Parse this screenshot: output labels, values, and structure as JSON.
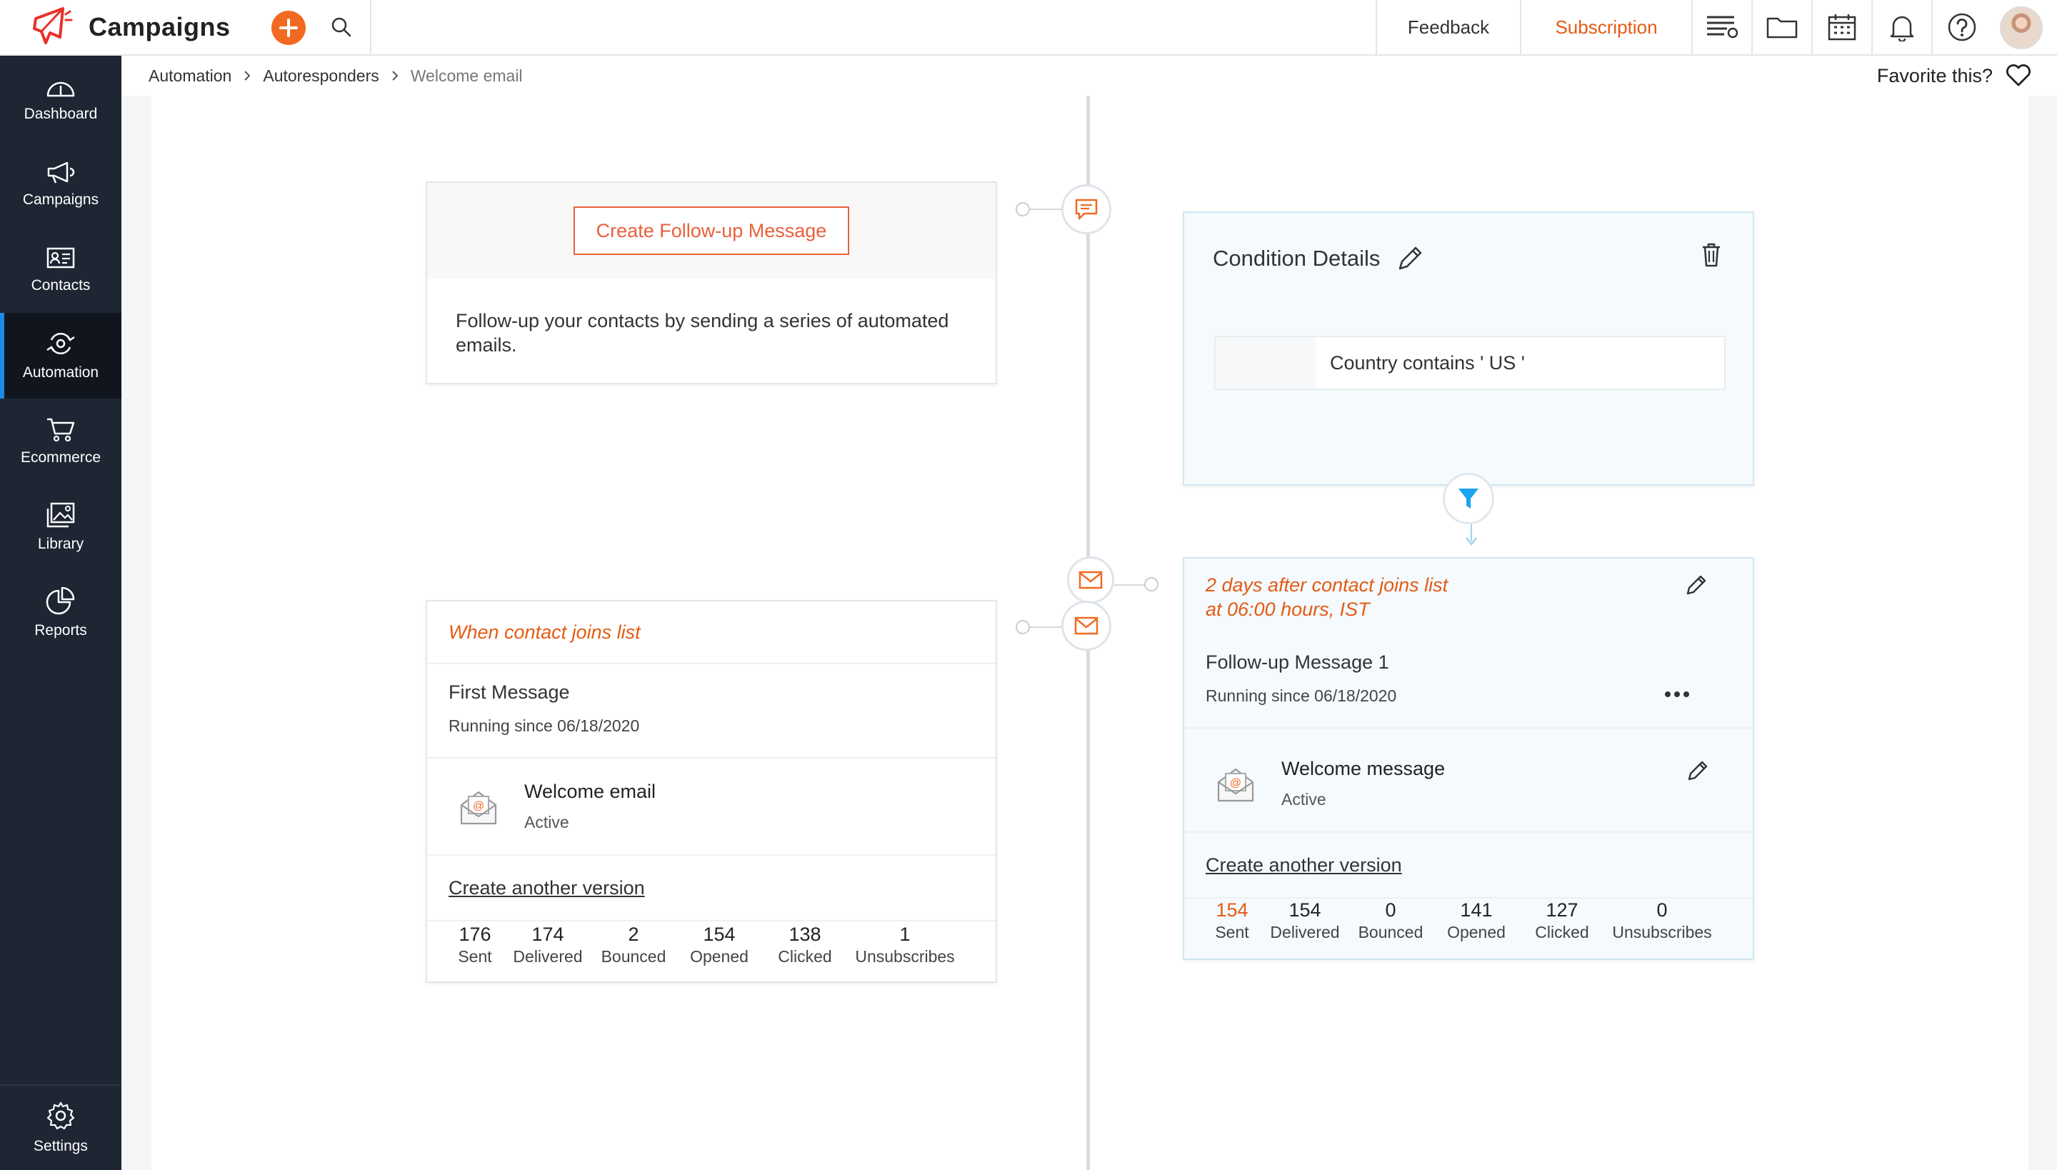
{
  "app": {
    "title": "Campaigns"
  },
  "topbar": {
    "feedback": "Feedback",
    "subscription": "Subscription",
    "icons": [
      "create-plus-icon",
      "search-icon",
      "list-view-icon",
      "folder-icon",
      "calendar-icon",
      "bell-icon",
      "help-icon",
      "user-avatar"
    ]
  },
  "sidebar": {
    "items": [
      {
        "label": "Dashboard",
        "icon": "dashboard-icon"
      },
      {
        "label": "Campaigns",
        "icon": "megaphone-icon"
      },
      {
        "label": "Contacts",
        "icon": "contact-card-icon"
      },
      {
        "label": "Automation",
        "icon": "automation-icon",
        "active": true
      },
      {
        "label": "Ecommerce",
        "icon": "cart-icon"
      },
      {
        "label": "Library",
        "icon": "gallery-icon"
      },
      {
        "label": "Reports",
        "icon": "pie-chart-icon"
      }
    ],
    "settings": "Settings"
  },
  "breadcrumb": {
    "items": [
      "Automation",
      "Autoresponders",
      "Welcome email"
    ],
    "favorite": "Favorite this?"
  },
  "followup_card": {
    "button": "Create Follow-up Message",
    "description": "Follow-up your contacts by sending a series of automated emails."
  },
  "condition_card": {
    "title": "Condition Details",
    "condition": "Country contains ' US '"
  },
  "first_message_card": {
    "trigger": "When contact joins list",
    "title": "First Message",
    "running": "Running  since 06/18/2020",
    "email_name": "Welcome email",
    "email_status": "Active",
    "version_link": "Create another version",
    "stats": [
      {
        "value": "176",
        "label": "Sent"
      },
      {
        "value": "174",
        "label": "Delivered"
      },
      {
        "value": "2",
        "label": "Bounced"
      },
      {
        "value": "154",
        "label": "Opened"
      },
      {
        "value": "138",
        "label": "Clicked"
      },
      {
        "value": "1",
        "label": "Unsubscribes"
      }
    ]
  },
  "followup_message_card": {
    "trigger_line1": "2  days after contact joins list",
    "trigger_line2": "at  06:00 hours, IST",
    "title": "Follow-up Message 1",
    "running": "Running  since 06/18/2020",
    "email_name": "Welcome message",
    "email_status": "Active",
    "version_link": "Create another version",
    "stats": [
      {
        "value": "154",
        "label": "Sent"
      },
      {
        "value": "154",
        "label": "Delivered"
      },
      {
        "value": "0",
        "label": "Bounced"
      },
      {
        "value": "141",
        "label": "Opened"
      },
      {
        "value": "127",
        "label": "Clicked"
      },
      {
        "value": "0",
        "label": "Unsubscribes"
      }
    ]
  },
  "colors": {
    "accent": "#f26a21",
    "sidebar": "#1e2533",
    "active_indicator": "#1e88e5",
    "filter": "#1aa3f0"
  }
}
